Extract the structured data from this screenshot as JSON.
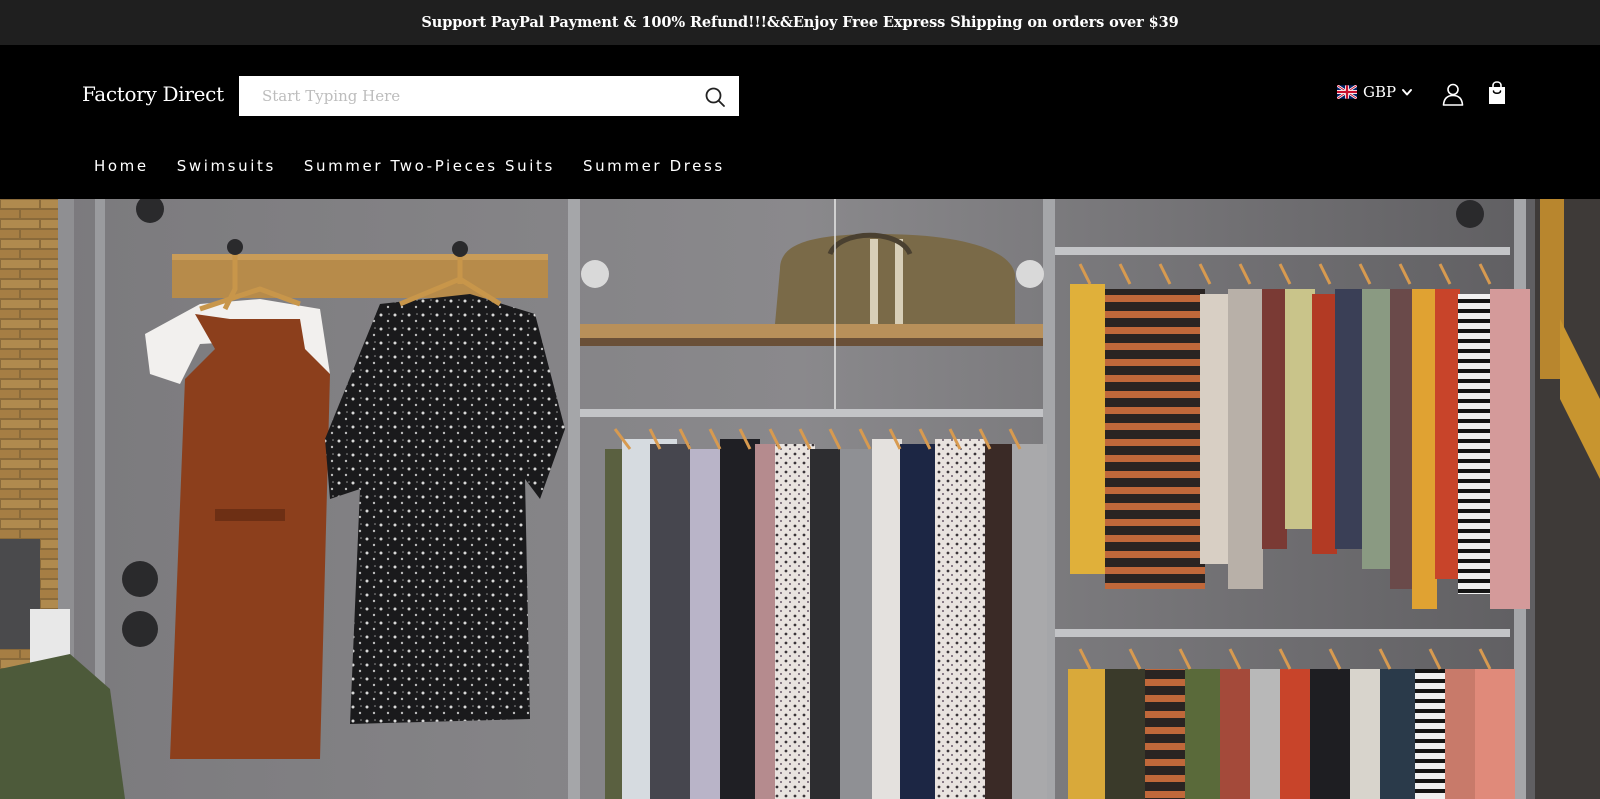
{
  "announcement": {
    "text": "Support PayPal Payment & 100% Refund!!!&&Enjoy Free Express Shipping on orders over $39"
  },
  "header": {
    "logo": "Factory Direct",
    "search": {
      "placeholder": "Start Typing Here",
      "value": "",
      "icon": "search-icon"
    },
    "currency": {
      "code": "GBP",
      "flag_icon": "uk-flag-icon",
      "dropdown_icon": "chevron-down-icon"
    },
    "account_icon": "user-icon",
    "cart_icon": "shopping-bag-icon"
  },
  "nav": {
    "items": [
      {
        "label": "Home"
      },
      {
        "label": "Swimsuits"
      },
      {
        "label": "Summer Two-Pieces Suits"
      },
      {
        "label": "Summer Dress"
      }
    ]
  },
  "hero": {
    "image_subject": "clothing-rack-photo"
  },
  "colors": {
    "announcement_bg": "#1f1f1f",
    "header_bg": "#000000",
    "text": "#ffffff"
  }
}
